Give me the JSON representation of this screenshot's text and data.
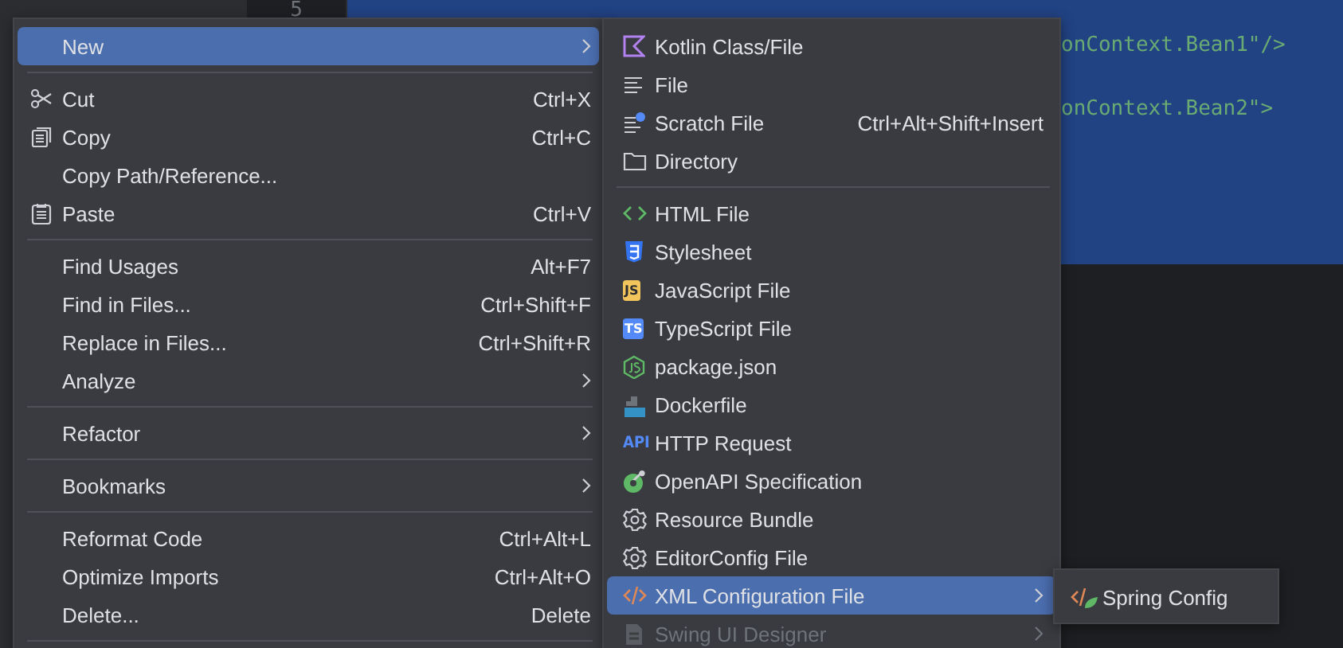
{
  "editor": {
    "gutter_line": "5",
    "code_lines": [
      "onContext.Bean1\"/>",
      "onContext.Bean2\">"
    ]
  },
  "main_menu": {
    "items": [
      {
        "kind": "item",
        "label": "New",
        "submenu": true,
        "selected": true,
        "disabled": false
      },
      {
        "kind": "separator"
      },
      {
        "kind": "item",
        "label": "Cut",
        "shortcut": "Ctrl+X",
        "submenu": false,
        "selected": false,
        "disabled": false
      },
      {
        "kind": "item",
        "label": "Copy",
        "shortcut": "Ctrl+C",
        "submenu": false,
        "selected": false,
        "disabled": false
      },
      {
        "kind": "item",
        "label": "Copy Path/Reference...",
        "submenu": false,
        "selected": false,
        "disabled": false
      },
      {
        "kind": "item",
        "label": "Paste",
        "shortcut": "Ctrl+V",
        "submenu": false,
        "selected": false,
        "disabled": false
      },
      {
        "kind": "separator"
      },
      {
        "kind": "item",
        "label": "Find Usages",
        "shortcut": "Alt+F7",
        "submenu": false,
        "selected": false,
        "disabled": false
      },
      {
        "kind": "item",
        "label": "Find in Files...",
        "shortcut": "Ctrl+Shift+F",
        "submenu": false,
        "selected": false,
        "disabled": false
      },
      {
        "kind": "item",
        "label": "Replace in Files...",
        "shortcut": "Ctrl+Shift+R",
        "submenu": false,
        "selected": false,
        "disabled": false
      },
      {
        "kind": "item",
        "label": "Analyze",
        "submenu": true,
        "selected": false,
        "disabled": false
      },
      {
        "kind": "separator"
      },
      {
        "kind": "item",
        "label": "Refactor",
        "submenu": true,
        "selected": false,
        "disabled": false
      },
      {
        "kind": "separator"
      },
      {
        "kind": "item",
        "label": "Bookmarks",
        "submenu": true,
        "selected": false,
        "disabled": false
      },
      {
        "kind": "separator"
      },
      {
        "kind": "item",
        "label": "Reformat Code",
        "shortcut": "Ctrl+Alt+L",
        "submenu": false,
        "selected": false,
        "disabled": false
      },
      {
        "kind": "item",
        "label": "Optimize Imports",
        "shortcut": "Ctrl+Alt+O",
        "submenu": false,
        "selected": false,
        "disabled": false
      },
      {
        "kind": "item",
        "label": "Delete...",
        "shortcut": "Delete",
        "submenu": false,
        "selected": false,
        "disabled": false
      },
      {
        "kind": "separator"
      }
    ]
  },
  "new_submenu": {
    "items": [
      {
        "kind": "item",
        "label": "Kotlin Class/File",
        "submenu": false,
        "selected": false,
        "disabled": false
      },
      {
        "kind": "item",
        "label": "File",
        "submenu": false,
        "selected": false,
        "disabled": false
      },
      {
        "kind": "item",
        "label": "Scratch File",
        "shortcut": "Ctrl+Alt+Shift+Insert",
        "submenu": false,
        "selected": false,
        "disabled": false
      },
      {
        "kind": "item",
        "label": "Directory",
        "submenu": false,
        "selected": false,
        "disabled": false
      },
      {
        "kind": "separator"
      },
      {
        "kind": "item",
        "label": "HTML File",
        "submenu": false,
        "selected": false,
        "disabled": false
      },
      {
        "kind": "item",
        "label": "Stylesheet",
        "submenu": false,
        "selected": false,
        "disabled": false
      },
      {
        "kind": "item",
        "label": "JavaScript File",
        "badge": "JS",
        "submenu": false,
        "selected": false,
        "disabled": false
      },
      {
        "kind": "item",
        "label": "TypeScript File",
        "badge": "TS",
        "submenu": false,
        "selected": false,
        "disabled": false
      },
      {
        "kind": "item",
        "label": "package.json",
        "submenu": false,
        "selected": false,
        "disabled": false
      },
      {
        "kind": "item",
        "label": "Dockerfile",
        "submenu": false,
        "selected": false,
        "disabled": false
      },
      {
        "kind": "item",
        "label": "HTTP Request",
        "badge": "API",
        "submenu": false,
        "selected": false,
        "disabled": false
      },
      {
        "kind": "item",
        "label": "OpenAPI Specification",
        "submenu": false,
        "selected": false,
        "disabled": false
      },
      {
        "kind": "item",
        "label": "Resource Bundle",
        "submenu": false,
        "selected": false,
        "disabled": false
      },
      {
        "kind": "item",
        "label": "EditorConfig File",
        "submenu": false,
        "selected": false,
        "disabled": false
      },
      {
        "kind": "item",
        "label": "XML Configuration File",
        "submenu": true,
        "selected": true,
        "disabled": false
      },
      {
        "kind": "item",
        "label": "Swing UI Designer",
        "submenu": true,
        "selected": false,
        "disabled": true
      }
    ]
  },
  "xml_submenu": {
    "items": [
      {
        "kind": "item",
        "label": "Spring Config",
        "submenu": false,
        "selected": false,
        "disabled": false
      }
    ]
  }
}
